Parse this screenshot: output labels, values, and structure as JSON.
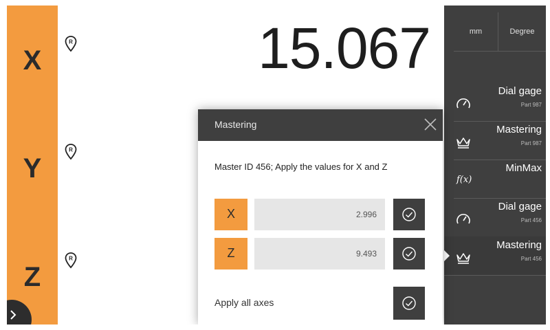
{
  "axes": [
    {
      "letter": "X",
      "value": "15.067",
      "ref_icon": "reference-pin-icon",
      "ref_mark": "R"
    },
    {
      "letter": "Y",
      "value": "",
      "ref_icon": "reference-pin-icon",
      "ref_mark": "R"
    },
    {
      "letter": "Z",
      "value": "",
      "ref_icon": "reference-pin-icon",
      "ref_mark": "R"
    }
  ],
  "units": {
    "linear": "mm",
    "angular": "Degree"
  },
  "functions": [
    {
      "title": "Dial gage",
      "subtitle": "Part 987",
      "icon": "dial-gauge-icon"
    },
    {
      "title": "Mastering",
      "subtitle": "Part 987",
      "icon": "crown-icon"
    },
    {
      "title": "MinMax",
      "subtitle": "",
      "icon": "fx-icon",
      "icon_text": "f(x)"
    },
    {
      "title": "Dial gage",
      "subtitle": "Part 456",
      "icon": "dial-gauge-icon"
    },
    {
      "title": "Mastering",
      "subtitle": "Part 456",
      "icon": "crown-icon",
      "active": true
    }
  ],
  "dialog": {
    "title": "Mastering",
    "message": "Master ID 456; Apply the values for X and Z",
    "rows": [
      {
        "axis": "X",
        "value": "2.996"
      },
      {
        "axis": "Z",
        "value": "9.493"
      }
    ],
    "apply_all_label": "Apply all axes"
  },
  "colors": {
    "accent_orange": "#f39b3f",
    "panel_dark": "#3f3f3f",
    "field_gray": "#e6e6e6"
  }
}
